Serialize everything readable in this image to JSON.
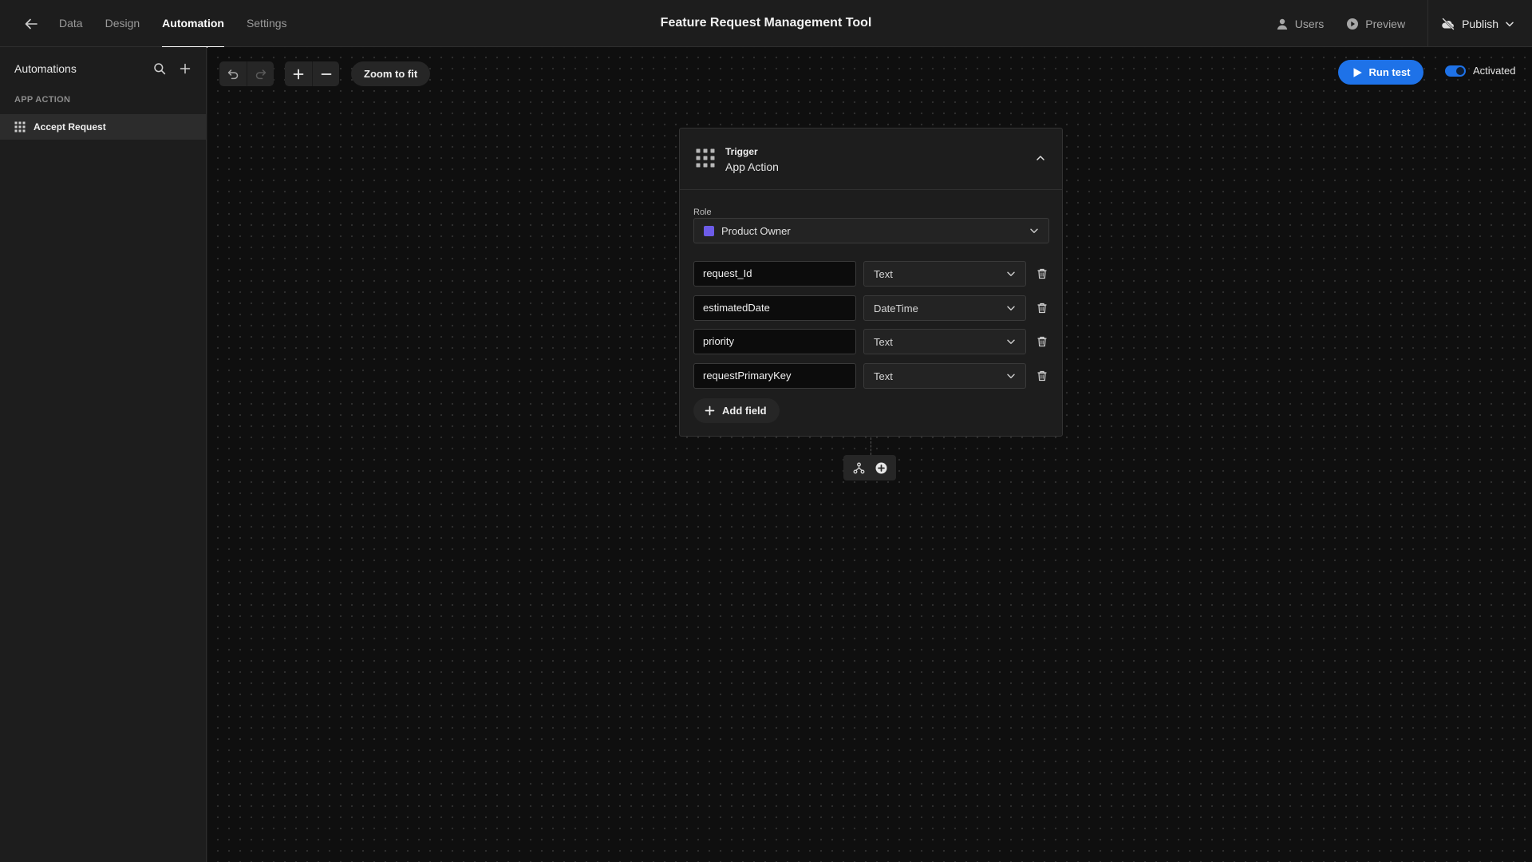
{
  "topbar": {
    "tabs": [
      {
        "label": "Data"
      },
      {
        "label": "Design"
      },
      {
        "label": "Automation"
      },
      {
        "label": "Settings"
      }
    ],
    "active_tab": "Automation",
    "app_title": "Feature Request Management Tool",
    "users_label": "Users",
    "preview_label": "Preview",
    "publish_label": "Publish"
  },
  "sidebar": {
    "title": "Automations",
    "section": "APP ACTION",
    "items": [
      {
        "label": "Accept Request",
        "selected": true
      }
    ]
  },
  "toolbar": {
    "zoom_fit_label": "Zoom to fit",
    "run_test_label": "Run test",
    "activated_label": "Activated",
    "activated": true
  },
  "trigger": {
    "kicker": "Trigger",
    "title": "App Action",
    "role_label": "Role",
    "role_value": "Product Owner",
    "role_color": "#6d5ce8",
    "fields": [
      {
        "name": "request_Id",
        "type": "Text"
      },
      {
        "name": "estimatedDate",
        "type": "DateTime"
      },
      {
        "name": "priority",
        "type": "Text"
      },
      {
        "name": "requestPrimaryKey",
        "type": "Text"
      }
    ],
    "add_field_label": "Add field"
  },
  "colors": {
    "accent": "#1e72e8",
    "canvas_bg": "#0f0f0f",
    "panel_bg": "#1d1d1d"
  },
  "icons": {
    "back": "arrow-left-icon",
    "search": "search-icon",
    "add": "plus-icon",
    "undo": "undo-icon",
    "redo": "redo-icon",
    "zoom_in": "plus-icon",
    "zoom_out": "minus-icon",
    "run": "play-icon",
    "drag": "grid-dots-icon",
    "collapse": "chevron-up-icon",
    "delete": "trash-icon",
    "branch": "branch-icon",
    "add_step": "plus-circle-icon"
  }
}
